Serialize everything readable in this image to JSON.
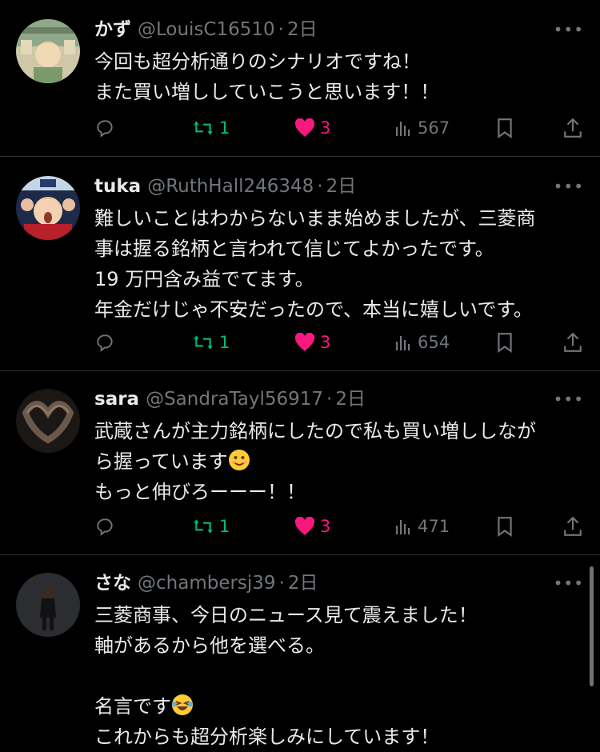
{
  "posts": [
    {
      "name": "かず",
      "handle": "@LouisC16510",
      "time": "2日",
      "text": "今回も超分析通りのシナリオですね！\nまた買い増ししていこうと思います！！",
      "retweets": "1",
      "likes": "3",
      "views": "567",
      "avatar_icon": "avatar-kazu"
    },
    {
      "name": "tuka",
      "handle": "@RuthHall246348",
      "time": "2日",
      "text": "難しいことはわからないまま始めましたが、三菱商\n事は握る銘柄と言われて信じてよかったです。\n19 万円含み益でてます。\n年金だけじゃ不安だったので、本当に嬉しいです。",
      "retweets": "1",
      "likes": "3",
      "views": "654",
      "avatar_icon": "avatar-tuka"
    },
    {
      "name": "sara",
      "handle": "@SandraTayl56917",
      "time": "2日",
      "text_line1": "武蔵さんが主力銘柄にしたので私も買い増ししなが",
      "text_line2": "ら握っています",
      "text_line3": "もっと伸びろーーー！！",
      "retweets": "1",
      "likes": "3",
      "views": "471",
      "avatar_icon": "avatar-sara"
    },
    {
      "name": "さな",
      "handle": "@chambersj39",
      "time": "2日",
      "text_line1": "三菱商事、今日のニュース見て震えました！",
      "text_line2": "軸があるから他を選べる。",
      "text_line3": "名言です",
      "text_line4": "これからも超分析楽しみにしています！",
      "avatar_icon": "avatar-sana"
    }
  ],
  "ui": {
    "separator": "·",
    "more": "•••"
  },
  "colors": {
    "background": "#000000",
    "text": "#e7e9ea",
    "muted": "#71767b",
    "retweet": "#00ba7c",
    "like": "#f91880",
    "divider": "#2f3336"
  },
  "icons": [
    "reply-icon",
    "retweet-icon",
    "heart-icon",
    "views-icon",
    "bookmark-icon",
    "share-icon",
    "more-icon",
    "smile-emoji",
    "laughing-emoji"
  ]
}
